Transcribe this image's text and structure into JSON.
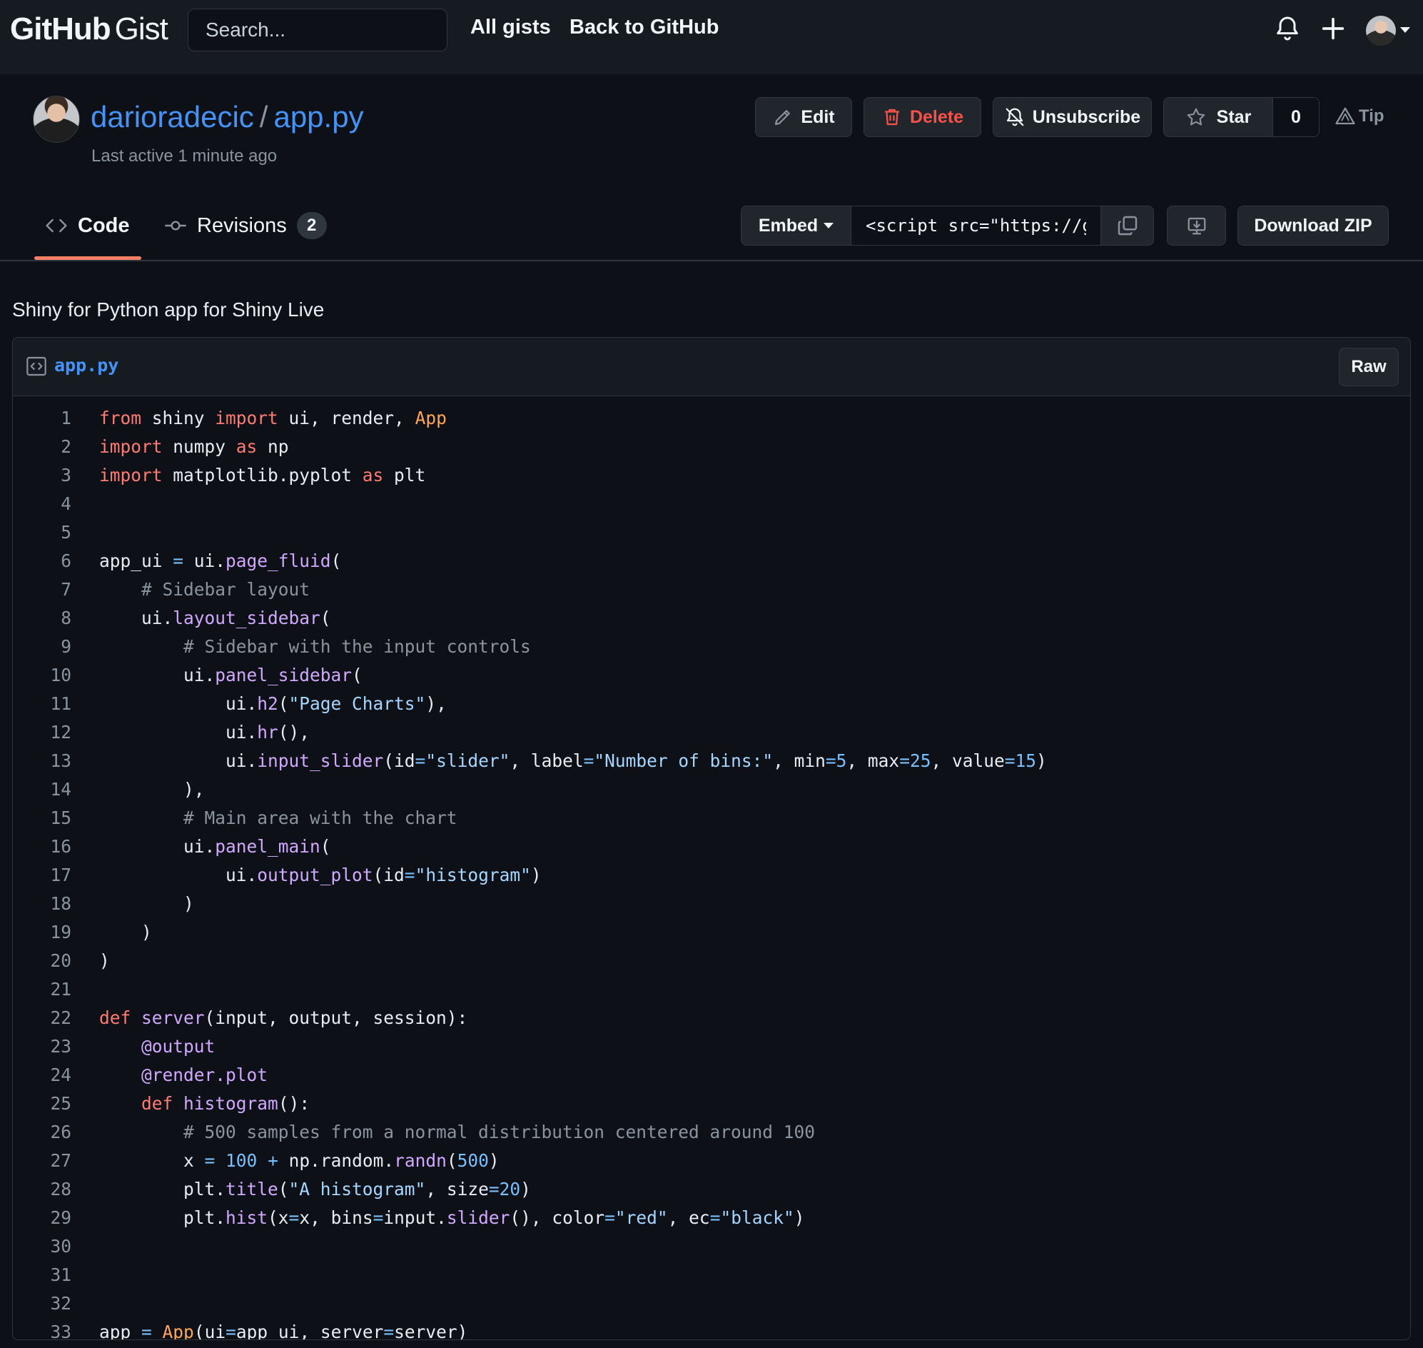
{
  "header": {
    "logo_main": "GitHub",
    "logo_sub": "Gist",
    "search_placeholder": "Search...",
    "nav": [
      "All gists",
      "Back to GitHub"
    ],
    "icons": [
      "bell-icon",
      "plus-icon",
      "avatar",
      "chevron-down-icon"
    ]
  },
  "gist": {
    "owner": "darioradecic",
    "separator": "/",
    "filename": "app.py",
    "last_active": "Last active 1 minute ago",
    "actions": {
      "edit": "Edit",
      "delete": "Delete",
      "unsubscribe": "Unsubscribe",
      "star": "Star",
      "star_count": "0",
      "tip": "Tip"
    }
  },
  "tabs": {
    "code": "Code",
    "revisions": "Revisions",
    "revisions_count": "2"
  },
  "toolbar": {
    "embed_label": "Embed",
    "embed_value": "<script src=\"https://gist.github.com/darioradecic",
    "download_zip": "Download ZIP"
  },
  "description": "Shiny for Python app for Shiny Live",
  "file": {
    "name": "app.py",
    "raw_label": "Raw"
  },
  "code_lines": [
    [
      [
        "kw",
        "from"
      ],
      [
        "t",
        " shiny "
      ],
      [
        "kw",
        "import"
      ],
      [
        "t",
        " ui, render, "
      ],
      [
        "cls",
        "App"
      ]
    ],
    [
      [
        "kw",
        "import"
      ],
      [
        "t",
        " numpy "
      ],
      [
        "kw",
        "as"
      ],
      [
        "t",
        " np"
      ]
    ],
    [
      [
        "kw",
        "import"
      ],
      [
        "t",
        " matplotlib.pyplot "
      ],
      [
        "kw",
        "as"
      ],
      [
        "t",
        " plt"
      ]
    ],
    [],
    [],
    [
      [
        "t",
        "app_ui "
      ],
      [
        "op",
        "="
      ],
      [
        "t",
        " ui."
      ],
      [
        "fn",
        "page_fluid"
      ],
      [
        "t",
        "("
      ]
    ],
    [
      [
        "t",
        "    "
      ],
      [
        "cm",
        "# Sidebar layout"
      ]
    ],
    [
      [
        "t",
        "    ui."
      ],
      [
        "fn",
        "layout_sidebar"
      ],
      [
        "t",
        "("
      ]
    ],
    [
      [
        "t",
        "        "
      ],
      [
        "cm",
        "# Sidebar with the input controls"
      ]
    ],
    [
      [
        "t",
        "        ui."
      ],
      [
        "fn",
        "panel_sidebar"
      ],
      [
        "t",
        "("
      ]
    ],
    [
      [
        "t",
        "            ui."
      ],
      [
        "fn",
        "h2"
      ],
      [
        "t",
        "("
      ],
      [
        "str",
        "\"Page Charts\""
      ],
      [
        "t",
        "),"
      ]
    ],
    [
      [
        "t",
        "            ui."
      ],
      [
        "fn",
        "hr"
      ],
      [
        "t",
        "(),"
      ]
    ],
    [
      [
        "t",
        "            ui."
      ],
      [
        "fn",
        "input_slider"
      ],
      [
        "t",
        "(id"
      ],
      [
        "op",
        "="
      ],
      [
        "str",
        "\"slider\""
      ],
      [
        "t",
        ", label"
      ],
      [
        "op",
        "="
      ],
      [
        "str",
        "\"Number of bins:\""
      ],
      [
        "t",
        ", min"
      ],
      [
        "op",
        "="
      ],
      [
        "num",
        "5"
      ],
      [
        "t",
        ", max"
      ],
      [
        "op",
        "="
      ],
      [
        "num",
        "25"
      ],
      [
        "t",
        ", value"
      ],
      [
        "op",
        "="
      ],
      [
        "num",
        "15"
      ],
      [
        "t",
        ")"
      ]
    ],
    [
      [
        "t",
        "        ),"
      ]
    ],
    [
      [
        "t",
        "        "
      ],
      [
        "cm",
        "# Main area with the chart"
      ]
    ],
    [
      [
        "t",
        "        ui."
      ],
      [
        "fn",
        "panel_main"
      ],
      [
        "t",
        "("
      ]
    ],
    [
      [
        "t",
        "            ui."
      ],
      [
        "fn",
        "output_plot"
      ],
      [
        "t",
        "(id"
      ],
      [
        "op",
        "="
      ],
      [
        "str",
        "\"histogram\""
      ],
      [
        "t",
        ")"
      ]
    ],
    [
      [
        "t",
        "        )"
      ]
    ],
    [
      [
        "t",
        "    )"
      ]
    ],
    [
      [
        "t",
        ")"
      ]
    ],
    [],
    [
      [
        "kw",
        "def"
      ],
      [
        "t",
        " "
      ],
      [
        "fn",
        "server"
      ],
      [
        "t",
        "(input, output, session):"
      ]
    ],
    [
      [
        "t",
        "    "
      ],
      [
        "fn",
        "@output"
      ]
    ],
    [
      [
        "t",
        "    "
      ],
      [
        "fn",
        "@render.plot"
      ]
    ],
    [
      [
        "t",
        "    "
      ],
      [
        "kw",
        "def"
      ],
      [
        "t",
        " "
      ],
      [
        "fn",
        "histogram"
      ],
      [
        "t",
        "():"
      ]
    ],
    [
      [
        "t",
        "        "
      ],
      [
        "cm",
        "# 500 samples from a normal distribution centered around 100"
      ]
    ],
    [
      [
        "t",
        "        x "
      ],
      [
        "op",
        "="
      ],
      [
        "t",
        " "
      ],
      [
        "num",
        "100"
      ],
      [
        "t",
        " "
      ],
      [
        "op",
        "+"
      ],
      [
        "t",
        " np.random."
      ],
      [
        "fn",
        "randn"
      ],
      [
        "t",
        "("
      ],
      [
        "num",
        "500"
      ],
      [
        "t",
        ")"
      ]
    ],
    [
      [
        "t",
        "        plt."
      ],
      [
        "fn",
        "title"
      ],
      [
        "t",
        "("
      ],
      [
        "str",
        "\"A histogram\""
      ],
      [
        "t",
        ", size"
      ],
      [
        "op",
        "="
      ],
      [
        "num",
        "20"
      ],
      [
        "t",
        ")"
      ]
    ],
    [
      [
        "t",
        "        plt."
      ],
      [
        "fn",
        "hist"
      ],
      [
        "t",
        "(x"
      ],
      [
        "op",
        "="
      ],
      [
        "t",
        "x, bins"
      ],
      [
        "op",
        "="
      ],
      [
        "t",
        "input."
      ],
      [
        "fn",
        "slider"
      ],
      [
        "t",
        "(), color"
      ],
      [
        "op",
        "="
      ],
      [
        "str",
        "\"red\""
      ],
      [
        "t",
        ", ec"
      ],
      [
        "op",
        "="
      ],
      [
        "str",
        "\"black\""
      ],
      [
        "t",
        ")"
      ]
    ],
    [],
    [],
    [],
    [
      [
        "t",
        "app "
      ],
      [
        "op",
        "="
      ],
      [
        "t",
        " "
      ],
      [
        "cls",
        "App"
      ],
      [
        "t",
        "(ui"
      ],
      [
        "op",
        "="
      ],
      [
        "t",
        "app_ui, server"
      ],
      [
        "op",
        "="
      ],
      [
        "t",
        "server)"
      ]
    ]
  ],
  "colors": {
    "background": "#0d1117",
    "header_bg": "#161b22",
    "link": "#4493f8",
    "danger": "#f85149",
    "tab_underline": "#f78166",
    "keyword": "#ff7b72",
    "class": "#ffa657",
    "function": "#d2a8ff",
    "string": "#a5d6ff",
    "number": "#79c0ff",
    "comment": "#8b949e"
  }
}
